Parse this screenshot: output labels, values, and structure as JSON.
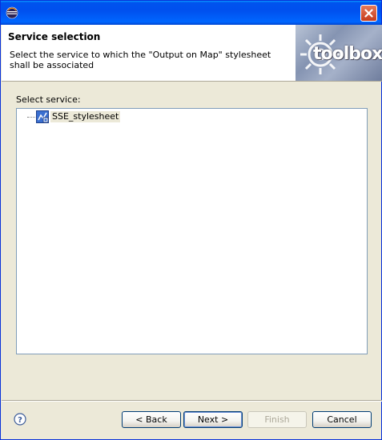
{
  "window": {
    "title": ""
  },
  "banner": {
    "title": "Service selection",
    "description": "Select the service to which the \"Output on Map\" stylesheet shall be associated",
    "logo_text": "toolbox"
  },
  "service_label": "Select service:",
  "tree": {
    "items": [
      {
        "label": "SSE_stylesheet",
        "selected": true
      }
    ]
  },
  "buttons": {
    "back": "< Back",
    "next": "Next >",
    "finish": "Finish",
    "cancel": "Cancel"
  },
  "colors": {
    "titlebar": "#0053ee",
    "dialog_background": "#ece9d8",
    "button_border": "#003c74",
    "disabled_text": "#aca899"
  },
  "icons": {
    "app": "eclipse-icon",
    "close": "close-icon",
    "service": "service-icon",
    "help": "help-icon",
    "logo": "gear-icon"
  }
}
